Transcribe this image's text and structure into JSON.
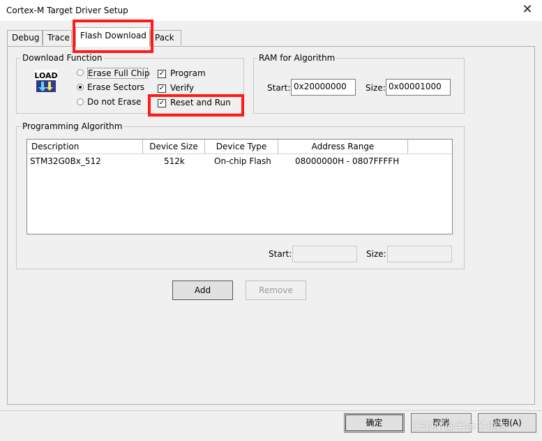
{
  "window": {
    "title": "Cortex-M Target Driver Setup",
    "close_glyph": "✕"
  },
  "tabs": [
    {
      "label": "Debug"
    },
    {
      "label": "Trace"
    },
    {
      "label": "Flash Download",
      "active": true
    },
    {
      "label": "Pack"
    }
  ],
  "download_function": {
    "group_label": "Download Function",
    "icon_text": "LOAD",
    "erase_options": [
      {
        "label": "Erase Full Chip",
        "selected": false
      },
      {
        "label": "Erase Sectors",
        "selected": true
      },
      {
        "label": "Do not Erase",
        "selected": false
      }
    ],
    "checkboxes": [
      {
        "label": "Program",
        "checked": true
      },
      {
        "label": "Verify",
        "checked": true
      },
      {
        "label": "Reset and Run",
        "checked": true
      }
    ]
  },
  "ram_for_algorithm": {
    "group_label": "RAM for Algorithm",
    "start_label": "Start:",
    "start_value": "0x20000000",
    "size_label": "Size:",
    "size_value": "0x00001000"
  },
  "programming_algorithm": {
    "group_label": "Programming Algorithm",
    "columns": [
      "Description",
      "Device Size",
      "Device Type",
      "Address Range"
    ],
    "rows": [
      {
        "description": "STM32G0Bx_512",
        "size": "512k",
        "type": "On-chip Flash",
        "range": "08000000H - 0807FFFFH"
      }
    ],
    "start_label": "Start:",
    "start_value": "",
    "size_label": "Size:",
    "size_value": ""
  },
  "buttons": {
    "add": "Add",
    "remove": "Remove",
    "ok": "确定",
    "cancel": "取消",
    "apply": "应用(A)"
  },
  "watermark": "CSDN @半吊子电工",
  "check_glyph": "✓",
  "highlight_color": "#ff1a1a"
}
